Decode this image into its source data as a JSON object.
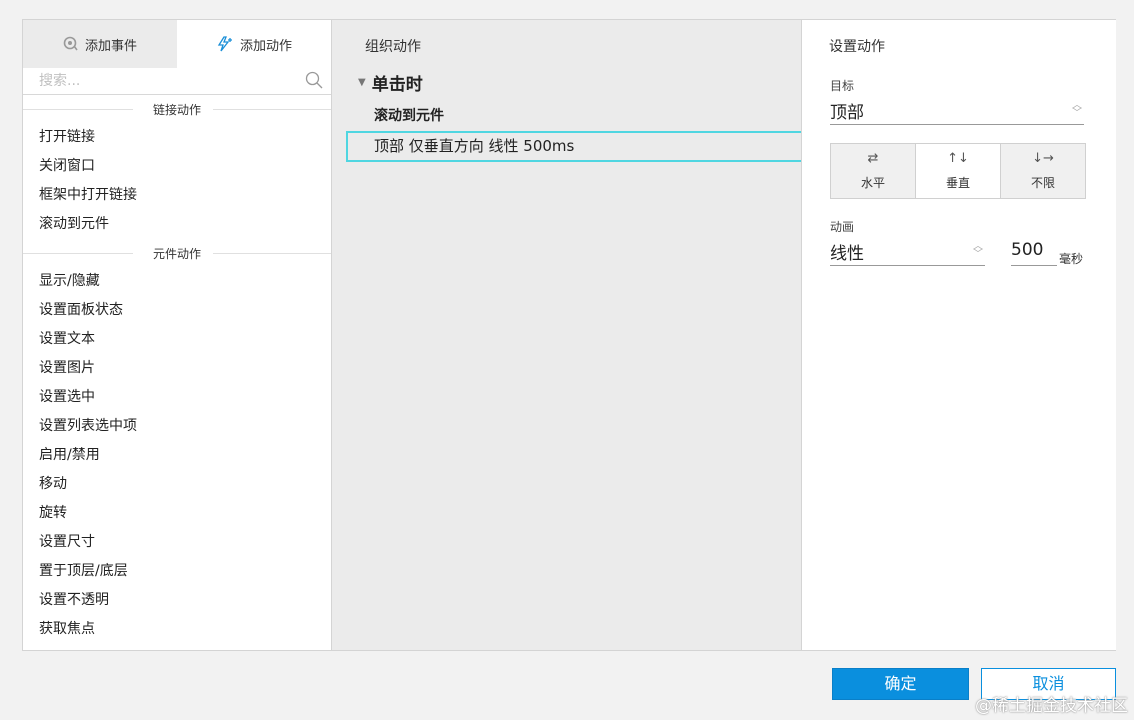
{
  "tabs": {
    "events": "添加事件",
    "actions": "添加动作"
  },
  "search": {
    "placeholder": "搜索..."
  },
  "groups": [
    {
      "header": "链接动作",
      "items": [
        "打开链接",
        "关闭窗口",
        "框架中打开链接",
        "滚动到元件"
      ]
    },
    {
      "header": "元件动作",
      "items": [
        "显示/隐藏",
        "设置面板状态",
        "设置文本",
        "设置图片",
        "设置选中",
        "设置列表选中项",
        "启用/禁用",
        "移动",
        "旋转",
        "设置尺寸",
        "置于顶层/底层",
        "设置不透明",
        "获取焦点"
      ]
    }
  ],
  "organize": {
    "title": "组织动作",
    "event": "单击时",
    "action": "滚动到元件",
    "action_detail": "顶部 仅垂直方向 线性 500ms"
  },
  "configure": {
    "title": "设置动作",
    "target_label": "目标",
    "target_value": "顶部",
    "directions": [
      "水平",
      "垂直",
      "不限"
    ],
    "selected_direction": "垂直",
    "animation_label": "动画",
    "animation_value": "线性",
    "duration": "500",
    "duration_unit": "毫秒"
  },
  "footer": {
    "ok": "确定",
    "cancel": "取消"
  },
  "watermark": "@稀土掘金技术社区",
  "colors": {
    "accent": "#0a8fde",
    "highlight": "#4fd6e1"
  }
}
